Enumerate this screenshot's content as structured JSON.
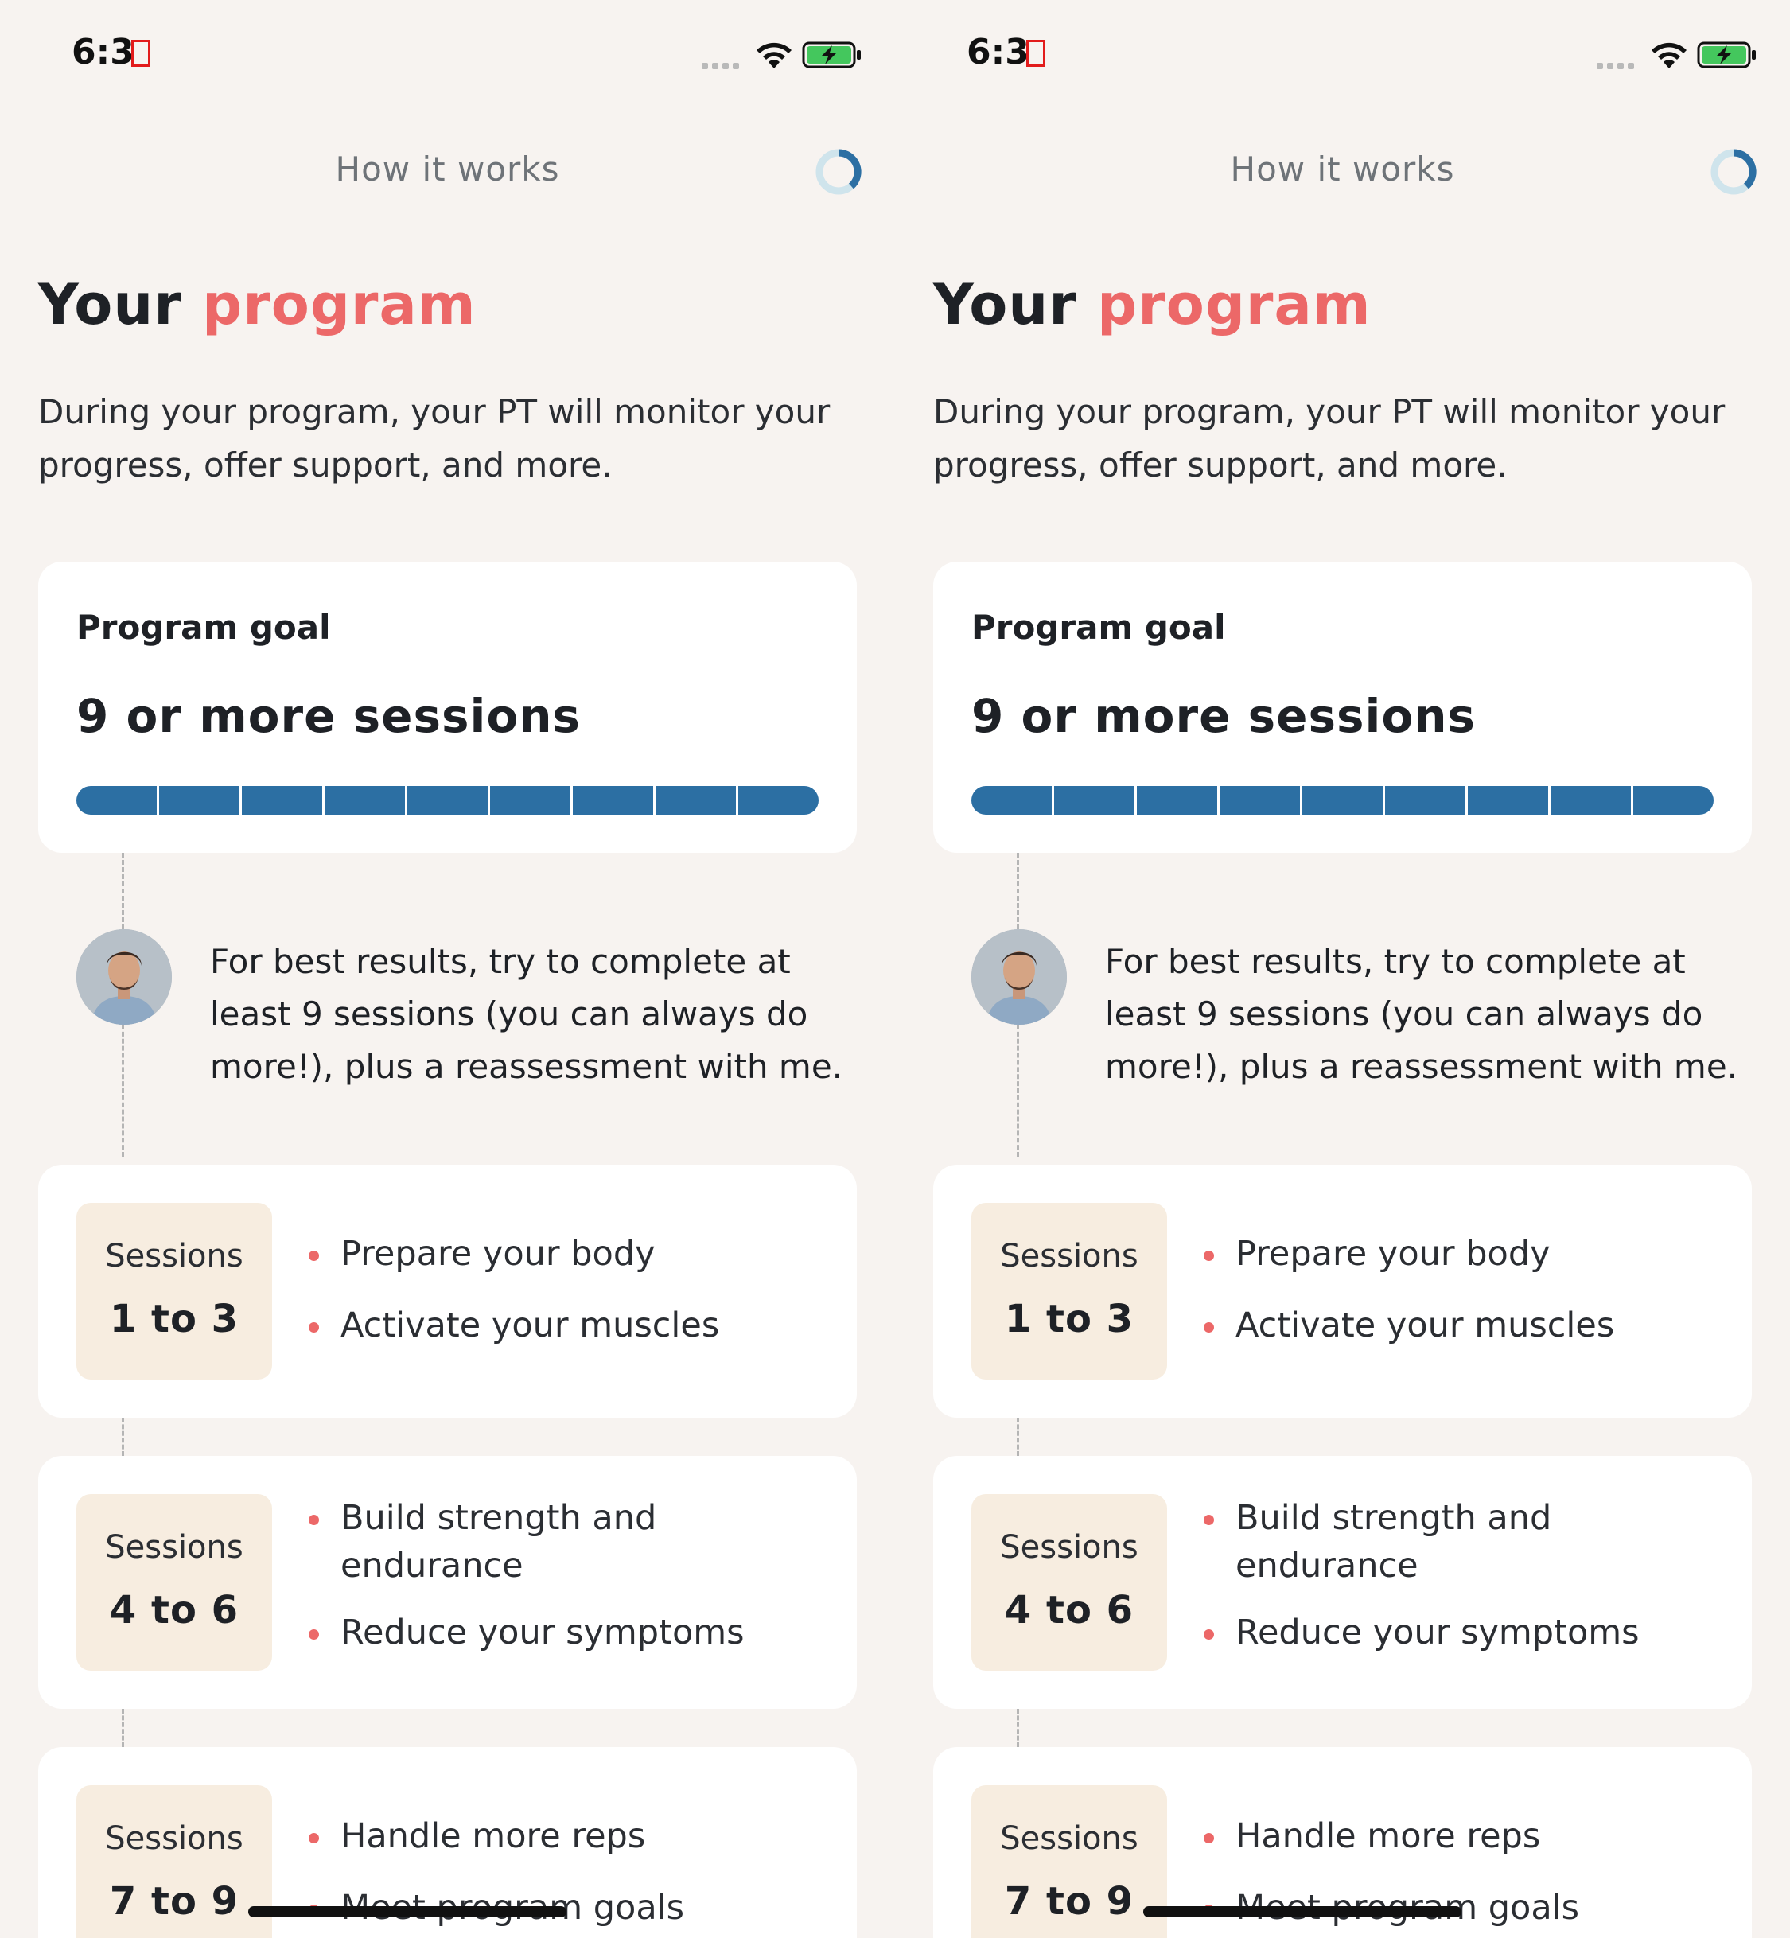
{
  "screens": [
    {
      "status": {
        "time": "6:3"
      },
      "header": {
        "title": "How it works"
      },
      "headline": {
        "prefix": "Your ",
        "accent": "program"
      },
      "intro": "During your program, your PT will monitor your progress, offer support, and more.",
      "goal": {
        "label": "Program goal",
        "value": "9 or more sessions",
        "segments_total": 9,
        "segments_completed": 9
      },
      "note": "For best results, try to complete at least 9 sessions (you can always do more!), plus a reassessment with me.",
      "sessions": [
        {
          "label": "Sessions",
          "range": "1 to 3",
          "items": [
            "Prepare your body",
            "Activate your muscles"
          ]
        },
        {
          "label": "Sessions",
          "range": "4 to 6",
          "items": [
            "Build strength and endurance",
            "Reduce your symptoms"
          ]
        },
        {
          "label": "Sessions",
          "range": "7 to 9",
          "items": [
            "Handle more reps",
            "Meet program goals"
          ]
        }
      ]
    },
    {
      "status": {
        "time": "6:3"
      },
      "header": {
        "title": "How it works"
      },
      "headline": {
        "prefix": "Your ",
        "accent": "program"
      },
      "intro": "During your program, your PT will monitor your progress, offer support, and more.",
      "goal": {
        "label": "Program goal",
        "value": "9 or more sessions",
        "segments_total": 9,
        "segments_completed": 9
      },
      "note": "For best results, try to complete at least 9 sessions (you can always do more!), plus a reassessment with me.",
      "sessions": [
        {
          "label": "Sessions",
          "range": "1 to 3",
          "items": [
            "Prepare your body",
            "Activate your muscles"
          ]
        },
        {
          "label": "Sessions",
          "range": "4 to 6",
          "items": [
            "Build strength and endurance",
            "Reduce your symptoms"
          ]
        },
        {
          "label": "Sessions",
          "range": "7 to 9",
          "items": [
            "Handle more reps",
            "Meet program goals"
          ]
        }
      ]
    }
  ],
  "colors": {
    "accent": "#ec6868",
    "segment": "#2c6fa3",
    "badge_bg": "#f7ede0",
    "page_bg": "#f7f3f0"
  },
  "icons": [
    "signal-icon",
    "wifi-icon",
    "battery-charging-icon",
    "progress-ring-icon",
    "avatar"
  ]
}
